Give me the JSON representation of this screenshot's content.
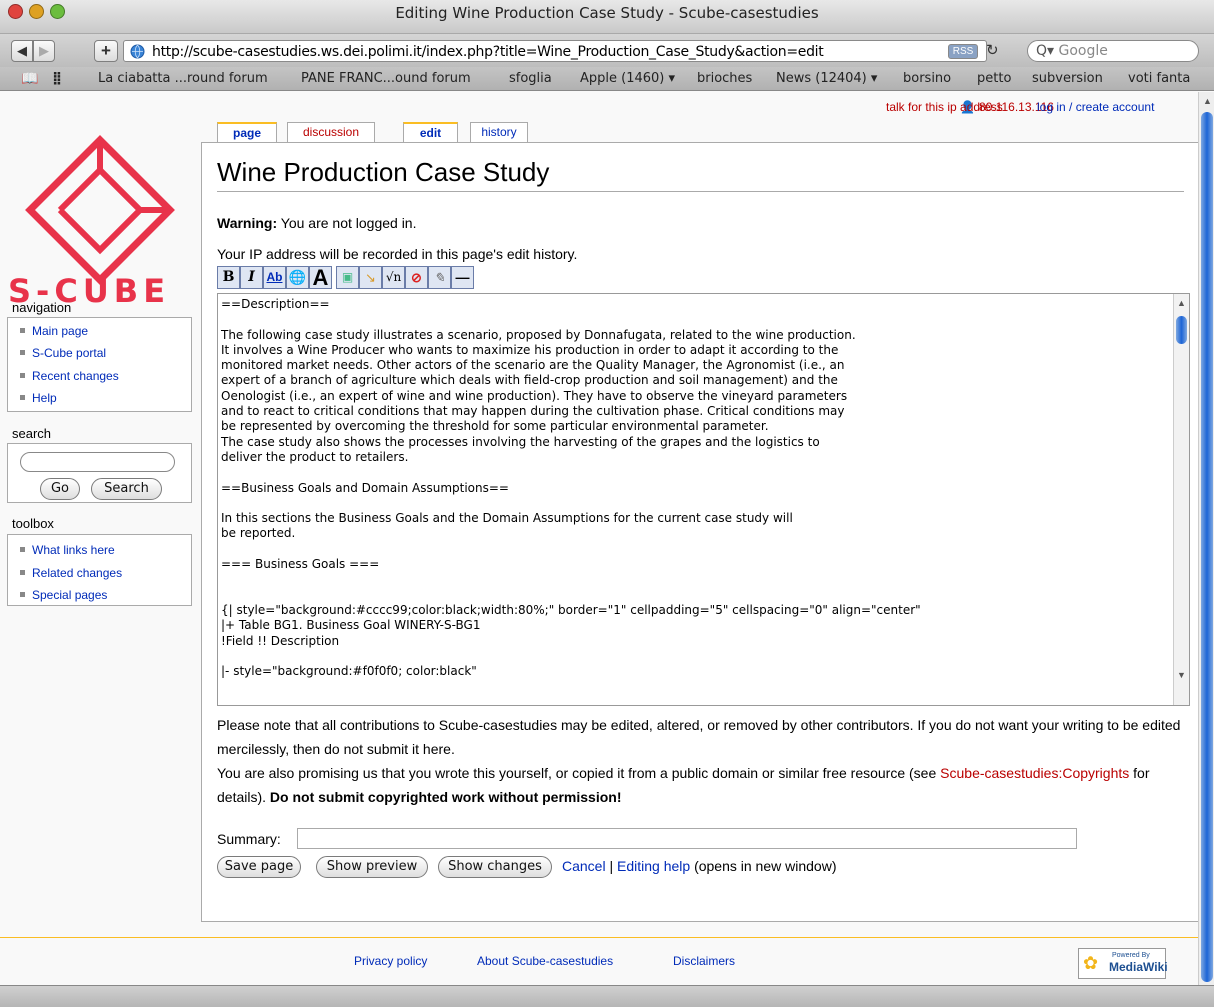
{
  "window": {
    "title": "Editing Wine Production Case Study - Scube-casestudies",
    "url": "http://scube-casestudies.ws.dei.polimi.it/index.php?title=Wine_Production_Case_Study&action=edit",
    "rss_label": "RSS",
    "search_placeholder": "Google"
  },
  "bookmarks": [
    "La ciabatta ...round forum",
    "PANE FRANC...ound forum",
    "sfoglia",
    "Apple (1460) ▾",
    "brioches",
    "News (12404) ▾",
    "borsino",
    "petto",
    "subversion",
    "voti fanta"
  ],
  "personal": {
    "ip": "80.116.13.116",
    "talk": "talk for this ip address",
    "login": "log in / create account"
  },
  "logo_text": "S-CUBE",
  "tabs": {
    "page": "page",
    "discussion": "discussion",
    "edit": "edit",
    "history": "history"
  },
  "heading": "Wine Production Case Study",
  "warning_bold": "Warning:",
  "warning_text": " You are not logged in.",
  "ip_note": "Your IP address will be recorded in this page's edit history.",
  "wikitext": "==Description==\n\nThe following case study illustrates a scenario, proposed by Donnafugata, related to the wine production.\nIt involves a Wine Producer who wants to maximize his production in order to adapt it according to the\nmonitored market needs. Other actors of the scenario are the Quality Manager, the Agronomist (i.e., an\nexpert of a branch of agriculture which deals with field-crop production and soil management) and the\nOenologist (i.e., an expert of wine and wine production). They have to observe the vineyard parameters\nand to react to critical conditions that may happen during the cultivation phase. Critical conditions may\nbe represented by overcoming the threshold for some particular environmental parameter.\nThe case study also shows the processes involving the harvesting of the grapes and the logistics to\ndeliver the product to retailers.\n\n==Business Goals and Domain Assumptions==\n\nIn this sections the Business Goals and the Domain Assumptions for the current case study will\nbe reported.\n\n=== Business Goals ===\n\n\n{| style=\"background:#cccc99;color:black;width:80%;\" border=\"1\" cellpadding=\"5\" cellspacing=\"0\" align=\"center\"\n|+ Table BG1. Business Goal WINERY-S-BG1\n!Field !! Description\n\n|- style=\"background:#f0f0f0; color:black\"",
  "note1": "Please note that all contributions to Scube-casestudies may be edited, altered, or removed by other contributors. If you do not want your writing to be edited mercilessly, then do not submit it here.",
  "note2a": "You are also promising us that you wrote this yourself, or copied it from a public domain or similar free resource (see ",
  "note2link": "Scube-casestudies:Copyrights",
  "note2b": " for details). ",
  "note2bold": "Do not submit copyrighted work without permission!",
  "summary_label": "Summary:",
  "summary_value": "",
  "buttons": {
    "save": "Save page",
    "preview": "Show preview",
    "changes": "Show changes"
  },
  "cancel": "Cancel",
  "sep": " | ",
  "editing_help": "Editing help",
  "opens_new": " (opens in new window)",
  "navigation": {
    "title": "navigation",
    "items": [
      "Main page",
      "S-Cube portal",
      "Recent changes",
      "Help"
    ]
  },
  "search": {
    "title": "search",
    "go": "Go",
    "search": "Search",
    "value": ""
  },
  "toolbox": {
    "title": "toolbox",
    "items": [
      "What links here",
      "Related changes",
      "Special pages"
    ]
  },
  "footer": {
    "privacy": "Privacy policy",
    "about": "About Scube-casestudies",
    "disclaimers": "Disclaimers",
    "badge_top": "Powered By",
    "badge_main": "MediaWiki"
  },
  "colors": {
    "logo": "#e8334a",
    "link": "#002bb8",
    "newlink": "#ba0000",
    "tab_accent": "#fabd23"
  }
}
